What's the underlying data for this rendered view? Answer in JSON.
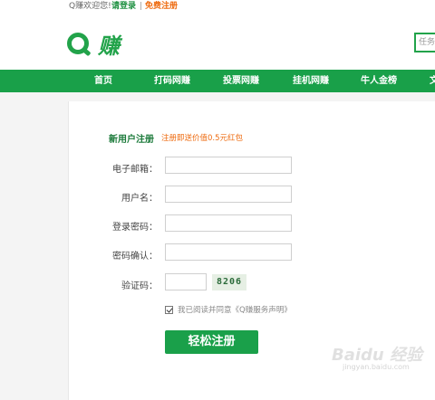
{
  "topbar": {
    "welcome": "Q赚欢迎您!",
    "login": "请登录",
    "separator": "|",
    "register": "免费注册"
  },
  "header": {
    "logo_text": "赚",
    "search_placeholder": "任务"
  },
  "nav": {
    "items": [
      {
        "label": "首页"
      },
      {
        "label": "打码网赚"
      },
      {
        "label": "投票网赚"
      },
      {
        "label": "挂机网赚"
      },
      {
        "label": "牛人金榜"
      },
      {
        "label": "文"
      }
    ]
  },
  "form": {
    "title": "新用户注册",
    "subtitle": "注册即送价值0.5元红包",
    "fields": {
      "email": {
        "label": "电子邮箱：",
        "value": ""
      },
      "username": {
        "label": "用户名：",
        "value": ""
      },
      "password": {
        "label": "登录密码：",
        "value": ""
      },
      "confirm": {
        "label": "密码确认：",
        "value": ""
      },
      "captcha": {
        "label": "验证码：",
        "value": "",
        "code": "8206"
      }
    },
    "agree_text": "我已阅读并同意《Q赚服务声明》",
    "agree_checked": true,
    "submit_label": "轻松注册"
  },
  "watermark": {
    "text": "Baidu 经验",
    "sub": "jingyan.baidu.com"
  },
  "colors": {
    "brand_green": "#19a049",
    "accent_orange": "#ee6b10"
  }
}
